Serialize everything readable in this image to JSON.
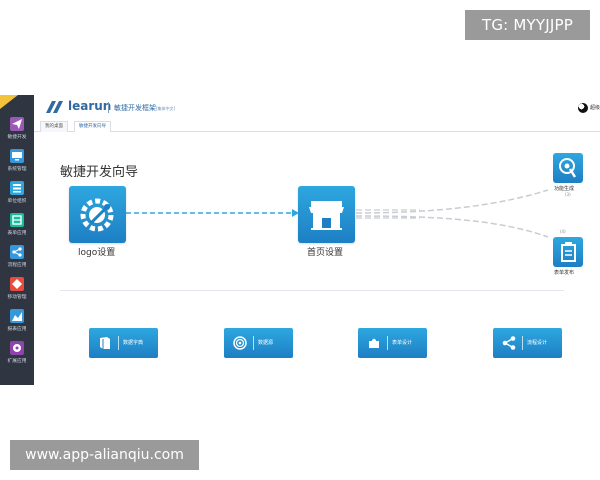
{
  "overlay": {
    "tg_badge": "TG: MYYJJPP",
    "watermark": "www.app-alianqiu.com"
  },
  "header": {
    "logo_text": "learun",
    "product_name": "敏捷开发框架",
    "edition": "[集体中文]",
    "user_name": "超级"
  },
  "sidebar": {
    "items": [
      {
        "label": "敏捷开发",
        "icon": "paper-plane-icon",
        "color": "#9b59b6"
      },
      {
        "label": "系统管理",
        "icon": "monitor-icon",
        "color": "#3498db"
      },
      {
        "label": "单位组织",
        "icon": "org-chart-icon",
        "color": "#2ea7df"
      },
      {
        "label": "表单应用",
        "icon": "form-icon",
        "color": "#1abc9c"
      },
      {
        "label": "流程应用",
        "icon": "share-icon",
        "color": "#3498db"
      },
      {
        "label": "移动管理",
        "icon": "mobile-icon",
        "color": "#e74c3c"
      },
      {
        "label": "报表应用",
        "icon": "chart-icon",
        "color": "#3498db"
      },
      {
        "label": "扩展应用",
        "icon": "puzzle-icon",
        "color": "#8e44ad"
      }
    ]
  },
  "tabs": [
    {
      "label": "我的桌面"
    },
    {
      "label": "敏捷开发向导"
    }
  ],
  "wizard": {
    "title": "敏捷开发向导",
    "logo_setting": "logo设置",
    "home_setting": "首页设置",
    "function_gen": "功能生成",
    "function_gen_sub": "(3)",
    "form_publish": "表单发布",
    "form_publish_sub": "(4)"
  },
  "quick_actions": [
    {
      "label": "数据字典",
      "icon": "book-icon"
    },
    {
      "label": "数据源",
      "icon": "target-icon"
    },
    {
      "label": "表单设计",
      "icon": "puzzle-icon"
    },
    {
      "label": "流程设计",
      "icon": "share-icon"
    }
  ],
  "colors": {
    "sidebar_bg": "#2f3541",
    "accent": "#1d7fc4",
    "tile_top": "#2ea7df",
    "brand": "#2f6aa3"
  }
}
